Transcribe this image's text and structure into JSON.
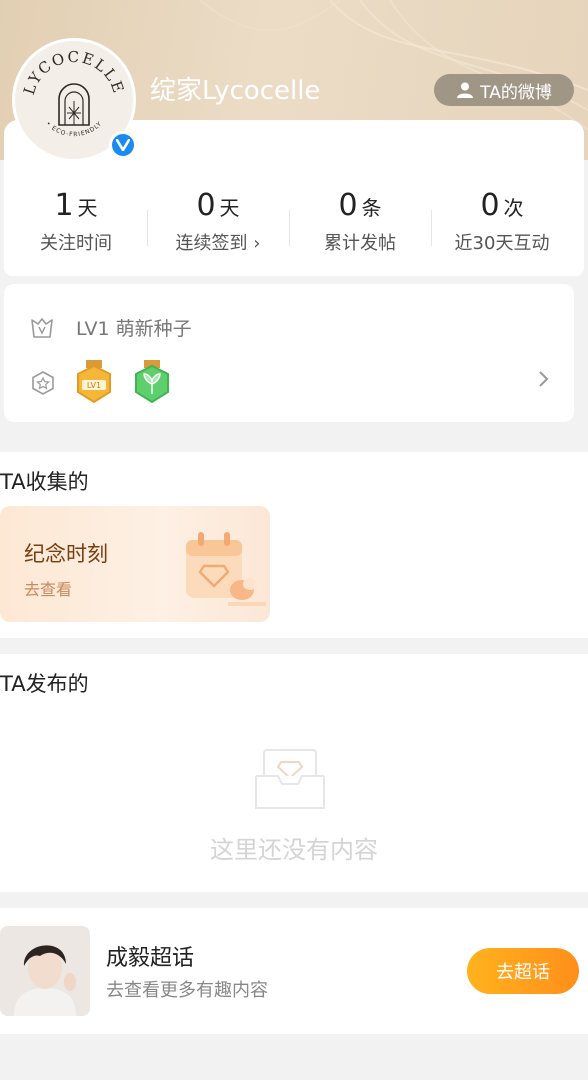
{
  "profile": {
    "name": "绽家Lycocelle",
    "logo_text_top": "LYCOCELLE",
    "logo_text_bottom": "• ECO-FRIENDLY",
    "weibo_button": "TA的微博"
  },
  "stats": [
    {
      "value": "1",
      "unit": "天",
      "label": "关注时间"
    },
    {
      "value": "0",
      "unit": "天",
      "label": "连续签到 ›"
    },
    {
      "value": "0",
      "unit": "条",
      "label": "累计发帖"
    },
    {
      "value": "0",
      "unit": "次",
      "label": "近30天互动"
    }
  ],
  "level": {
    "text": "LV1 萌新种子",
    "badge1_label": "LV1"
  },
  "collected": {
    "title": "TA收集的",
    "card_title": "纪念时刻",
    "card_sub": "去查看"
  },
  "published": {
    "title": "TA发布的",
    "empty_text": "这里还没有内容"
  },
  "supertopic": {
    "title": "成毅超话",
    "subtitle": "去查看更多有趣内容",
    "button": "去超话"
  },
  "colors": {
    "accent": "#ff9a1a",
    "verified": "#1a8cf0",
    "header_bg": "#e6d4bb"
  }
}
